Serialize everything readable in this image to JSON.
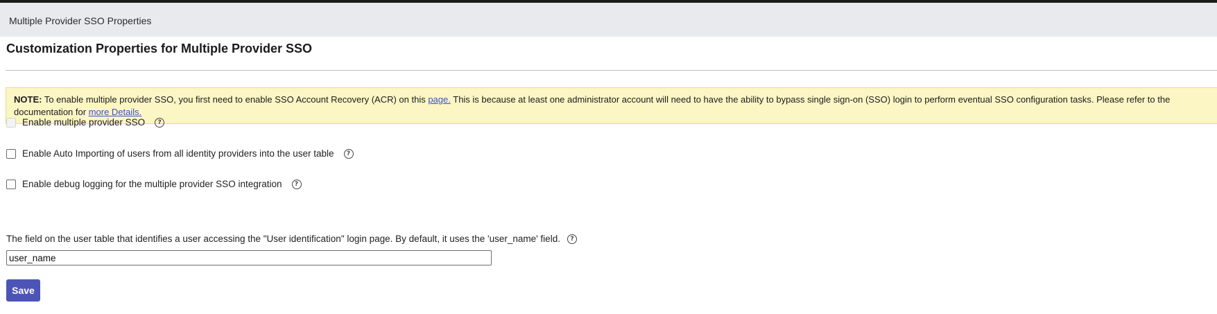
{
  "window": {
    "title": "Multiple Provider SSO Properties"
  },
  "page": {
    "heading": "Customization Properties for Multiple Provider SSO"
  },
  "note": {
    "label": "NOTE:",
    "text_1": " To enable multiple provider SSO, you first need to enable SSO Account Recovery (ACR) on this ",
    "link_1": "page.",
    "text_2": "  This is because at least one administrator account will need to have the ability to bypass single sign-on (SSO) login to perform eventual SSO configuration tasks. Please refer to the documentation for ",
    "link_2": "more Details."
  },
  "options": [
    {
      "label": "Enable multiple provider SSO",
      "checked": false,
      "disabled": true
    },
    {
      "label": "Enable Auto Importing of users from all identity providers into the user table",
      "checked": false,
      "disabled": false
    },
    {
      "label": "Enable debug logging for the multiple provider SSO integration",
      "checked": false,
      "disabled": false
    }
  ],
  "user_field": {
    "label": "The field on the user table that identifies a user accessing the \"User identification\" login page. By default, it uses the 'user_name' field.",
    "value": "user_name"
  },
  "buttons": {
    "save": "Save"
  },
  "icons": {
    "help": "help-circle-icon"
  },
  "colors": {
    "accent": "#4d54b8",
    "note_bg": "#fcf6c4",
    "link": "#3b4fc8"
  }
}
